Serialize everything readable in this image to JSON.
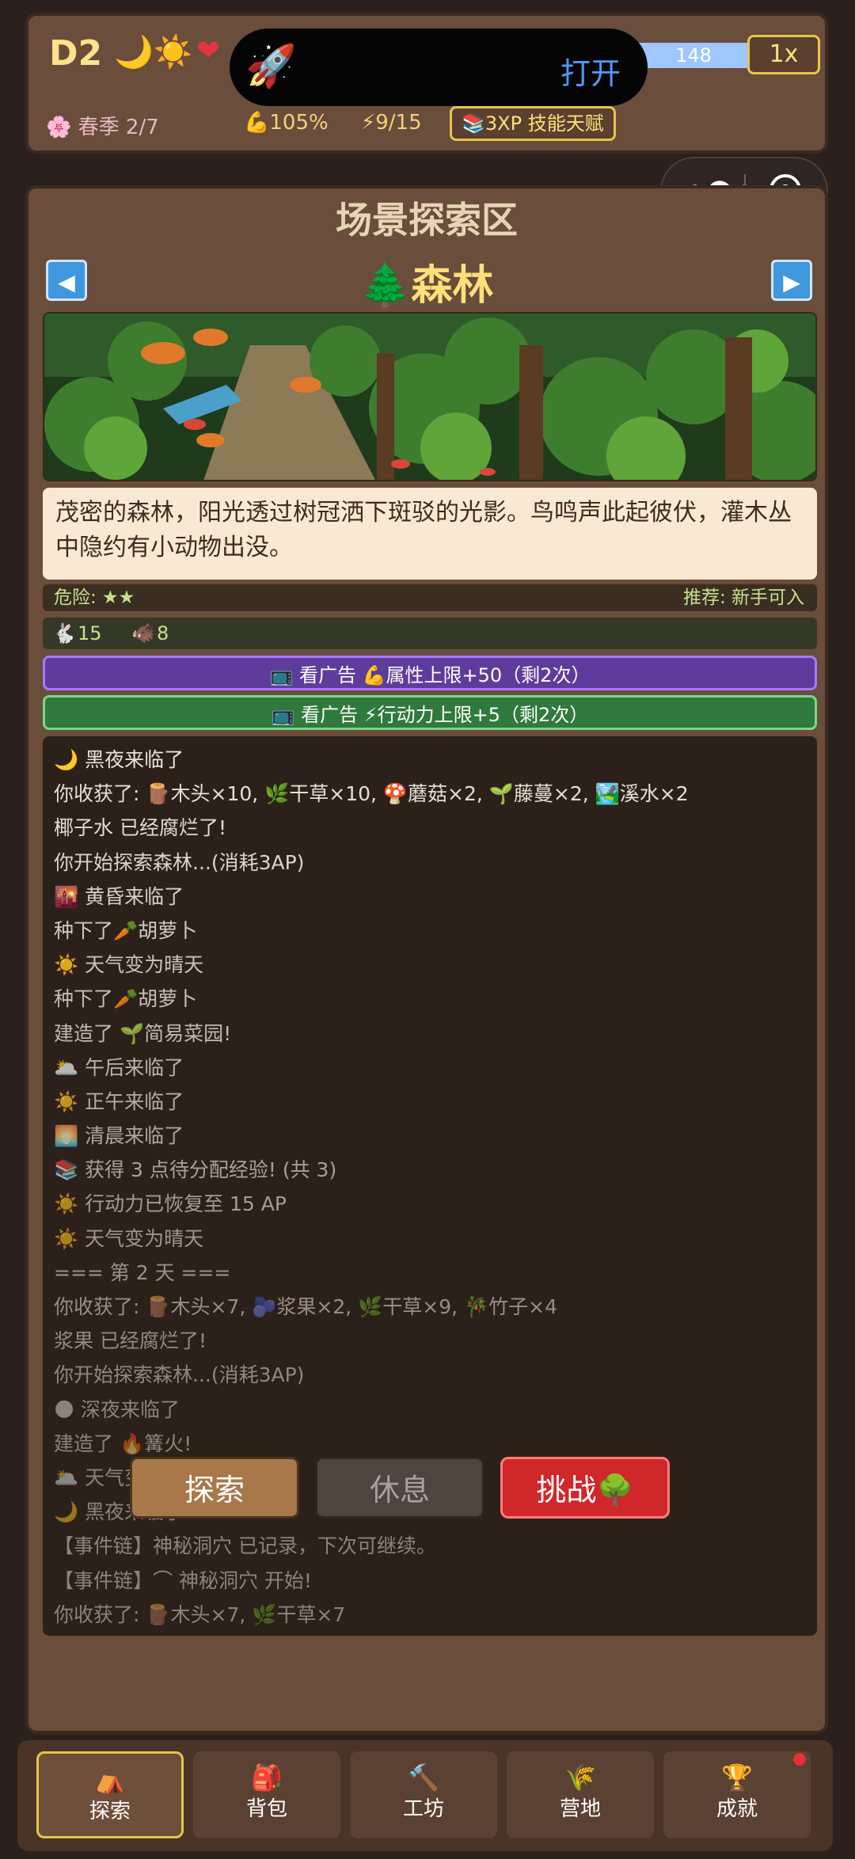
{
  "status": {
    "day": "D2",
    "time_icons": "🌙☀️",
    "heart_icon": "❤",
    "hp_value": "148",
    "speed": "1x",
    "season": "🌸 春季 2/7",
    "strength": "💪105%",
    "energy": "⚡9/15",
    "xp_badge": "📚3XP 技能天赋"
  },
  "overlay": {
    "open_label": "打开"
  },
  "zone": {
    "title": "场景探索区",
    "location": "🌲森林",
    "description": "茂密的森林，阳光透过树冠洒下斑驳的光影。鸟鸣声此起彼伏，灌木丛中隐约有小动物出没。",
    "danger": "危险: ★★",
    "recommend": "推荐: 新手可入",
    "animals": [
      {
        "icon": "🐇",
        "count": "15"
      },
      {
        "icon": "🐗",
        "count": "8"
      }
    ],
    "ad_buttons": [
      "📺 看广告 💪属性上限+50（剩2次）",
      "📺 看广告 ⚡行动力上限+5（剩2次）"
    ]
  },
  "log": [
    "🌙 黑夜来临了",
    "你收获了: 🪵木头×10, 🌿干草×10, 🍄蘑菇×2, 🌱藤蔓×2, 🏞️溪水×2",
    "椰子水 已经腐烂了!",
    "你开始探索森林...(消耗3AP)",
    "🌇 黄昏来临了",
    "种下了🥕胡萝卜",
    "☀️ 天气变为晴天",
    "种下了🥕胡萝卜",
    "建造了 🌱简易菜园!",
    "🌥️ 午后来临了",
    "☀️ 正午来临了",
    "🌅 清晨来临了",
    "📚 获得 3 点待分配经验! (共 3)",
    "☀️ 行动力已恢复至 15 AP",
    "☀️ 天气变为晴天",
    "=== 第 2 天 ===",
    "你收获了: 🪵木头×7, 🫐浆果×2, 🌿干草×9, 🎋竹子×4",
    "浆果 已经腐烂了!",
    "你开始探索森林...(消耗3AP)",
    "🌑 深夜来临了",
    "建造了 🔥篝火!",
    "🌥️ 天气变为多云",
    "🌙 黑夜来临了",
    "【事件链】神秘洞穴 已记录，下次可继续。",
    "【事件链】⌒ 神秘洞穴 开始!",
    "你收获了: 🪵木头×7, 🌿干草×7"
  ],
  "actions": {
    "explore": "探索",
    "rest": "休息",
    "challenge": "挑战🌳"
  },
  "nav": [
    {
      "icon": "⛺",
      "label": "探索"
    },
    {
      "icon": "🎒",
      "label": "背包"
    },
    {
      "icon": "🔨",
      "label": "工坊"
    },
    {
      "icon": "🌾",
      "label": "营地"
    },
    {
      "icon": "🏆",
      "label": "成就"
    }
  ]
}
